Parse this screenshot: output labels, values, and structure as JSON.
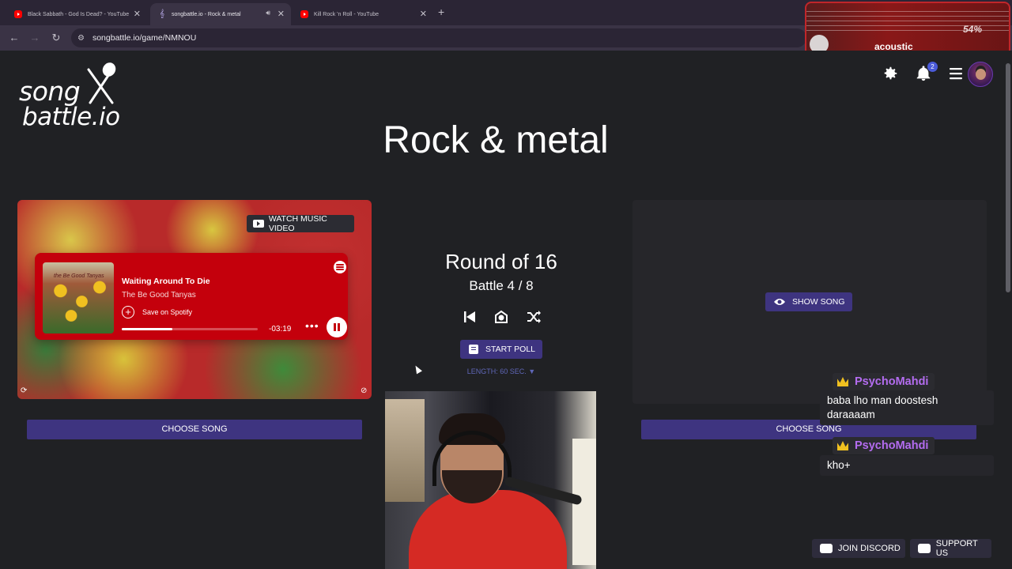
{
  "browser": {
    "tabs": [
      {
        "title": "Black Sabbath - God Is Dead? - YouTube",
        "icon": "youtube-icon"
      },
      {
        "title": "songbattle.io - Rock & metal",
        "icon": "songbattle-icon"
      },
      {
        "title": "Kill Rock 'n Roll - YouTube",
        "icon": "youtube-icon"
      }
    ],
    "url": "songbattle.io/game/NMNOU"
  },
  "overlay": {
    "percent": "54%",
    "label": "acoustic"
  },
  "header": {
    "logo_line1": "song",
    "logo_line2": "battle.io",
    "notification_count": "2"
  },
  "page_title": "Rock & metal",
  "left": {
    "watch_label": "WATCH MUSIC VIDEO",
    "track": {
      "title": "Waiting Around To Die",
      "artist": "The Be Good Tanyas",
      "save_label": "Save on Spotify",
      "time_remaining": "-03:19",
      "progress": 0.37,
      "cover_text": "the Be Good Tanyas"
    },
    "choose_label": "CHOOSE SONG"
  },
  "center": {
    "round": "Round of 16",
    "battle": "Battle 4 / 8",
    "poll_label": "START POLL",
    "length_label": "LENGTH: 60 SEC. ▼"
  },
  "right": {
    "show_label": "SHOW SONG",
    "choose_label": "CHOOSE SONG"
  },
  "chat": [
    {
      "user": "PsychoMahdi",
      "message": "baba lho man doostesh daraaaam"
    },
    {
      "user": "PsychoMahdi",
      "message": "kho+"
    }
  ],
  "footer": {
    "discord_label": "JOIN DISCORD",
    "support_label": "SUPPORT US"
  },
  "colors": {
    "accent": "#3e3480",
    "spotify": "#c4000c",
    "chat_name": "#b46cf0"
  }
}
